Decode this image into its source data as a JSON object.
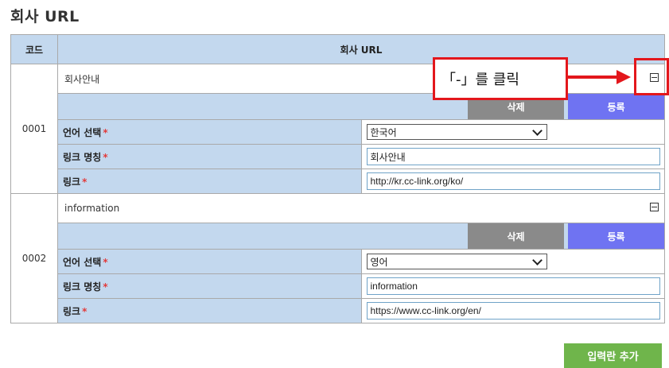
{
  "page_title": "회사 URL",
  "table": {
    "col_code": "코드",
    "col_url": "회사 URL",
    "labels": {
      "language": "언어 선택",
      "link_name": "링크 명칭",
      "link": "링크",
      "required_mark": "*"
    },
    "buttons": {
      "delete": "삭제",
      "register": "등록"
    },
    "rows": [
      {
        "code": "0001",
        "name": "회사안내",
        "language": "한국어",
        "link_name": "회사안내",
        "link": "http://kr.cc-link.org/ko/"
      },
      {
        "code": "0002",
        "name": "information",
        "language": "영어",
        "link_name": "information",
        "link": "https://www.cc-link.org/en/"
      }
    ]
  },
  "add_button": "입력란 추가",
  "callout": {
    "text": "「-」를 클릭"
  },
  "colors": {
    "header_bg": "#c3d8ee",
    "delete_btn": "#8a8a8a",
    "register_btn": "#6f73f2",
    "add_btn": "#6fb54b",
    "annotation": "#e3171c"
  },
  "icons": {
    "toggle": "collapse-minus-icon",
    "dropdown": "chevron-down-icon"
  }
}
